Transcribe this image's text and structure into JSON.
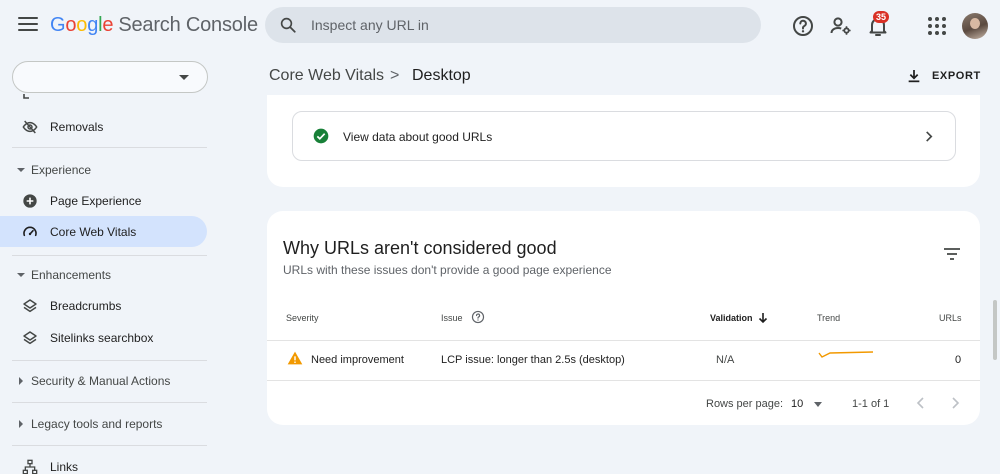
{
  "header": {
    "logo_parts": [
      "G",
      "o",
      "o",
      "g",
      "l",
      "e"
    ],
    "product_name": "Search Console",
    "search_placeholder": "Inspect any URL in",
    "notification_count": "35"
  },
  "sidebar": {
    "removals_label": "Removals",
    "experience_label": "Experience",
    "page_experience_label": "Page Experience",
    "core_web_vitals_label": "Core Web Vitals",
    "enhancements_label": "Enhancements",
    "breadcrumbs_label": "Breadcrumbs",
    "sitelinks_label": "Sitelinks searchbox",
    "security_label": "Security & Manual Actions",
    "legacy_label": "Legacy tools and reports",
    "links_label": "Links"
  },
  "breadcrumb": {
    "parent": "Core Web Vitals",
    "separator": ">",
    "current": "Desktop"
  },
  "toolbar": {
    "export_label": "EXPORT"
  },
  "good_urls": {
    "label": "View data about good URLs"
  },
  "issues_card": {
    "title": "Why URLs aren't considered good",
    "subtitle": "URLs with these issues don't provide a good page experience",
    "columns": {
      "severity": "Severity",
      "issue": "Issue",
      "validation": "Validation",
      "trend": "Trend",
      "urls": "URLs"
    },
    "rows": [
      {
        "severity": "Need improvement",
        "issue": "LCP issue: longer than 2.5s (desktop)",
        "validation": "N/A",
        "urls": "0"
      }
    ],
    "footer": {
      "rows_per_page_label": "Rows per page:",
      "rows_per_page_value": "10",
      "range": "1-1 of 1"
    }
  },
  "colors": {
    "accent_blue": "#1a73e8",
    "good_green": "#188038",
    "warning_orange": "#f29900",
    "badge_red": "#d93025",
    "active_nav_bg": "#d3e3fd"
  }
}
